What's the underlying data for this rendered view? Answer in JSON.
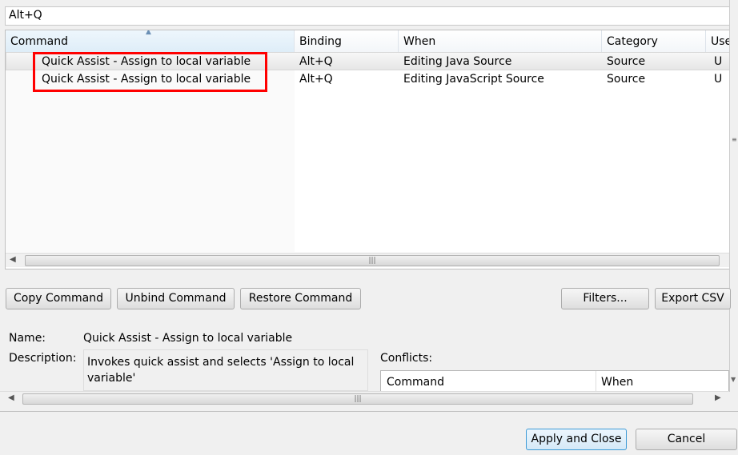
{
  "filter": {
    "value": "Alt+Q"
  },
  "table": {
    "columns": [
      "Command",
      "Binding",
      "When",
      "Category",
      "Use"
    ],
    "rows": [
      {
        "command": "Quick Assist - Assign to local variable",
        "binding": "Alt+Q",
        "when": "Editing Java Source",
        "category": "Source",
        "user": "U"
      },
      {
        "command": "Quick Assist - Assign to local variable",
        "binding": "Alt+Q",
        "when": "Editing JavaScript Source",
        "category": "Source",
        "user": "U"
      }
    ]
  },
  "buttons": {
    "copy": "Copy Command",
    "unbind": "Unbind Command",
    "restore": "Restore Command",
    "filters": "Filters...",
    "export": "Export CSV",
    "apply": "Apply and Close",
    "cancel": "Cancel"
  },
  "details": {
    "name_label": "Name:",
    "name": "Quick Assist - Assign to local variable",
    "desc_label": "Description:",
    "description": "Invokes quick assist and selects 'Assign to local variable'",
    "conflicts_label": "Conflicts:",
    "conflict_columns": [
      "Command",
      "When"
    ]
  },
  "highlight_color": "#ff0000"
}
